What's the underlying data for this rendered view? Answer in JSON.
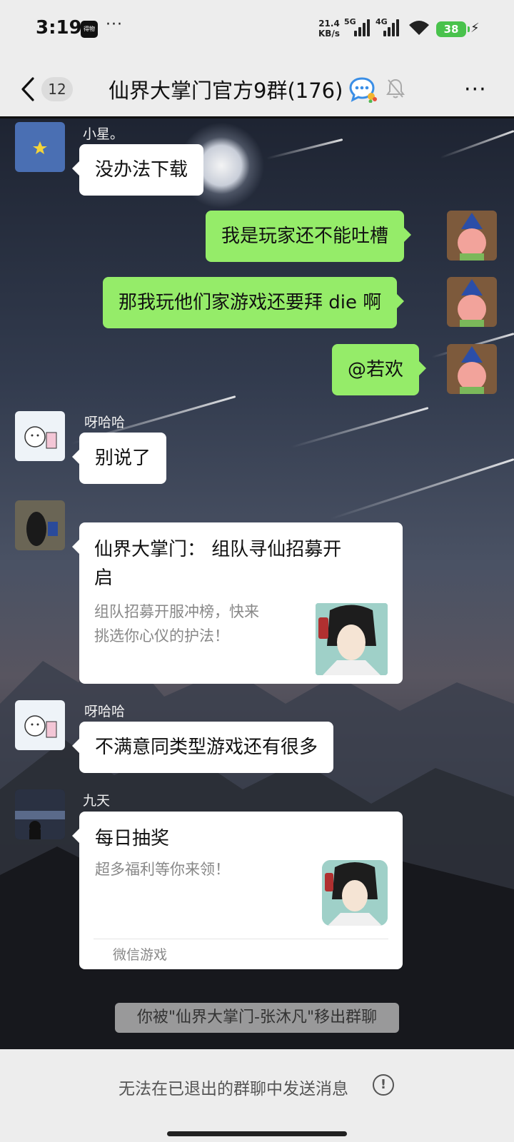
{
  "status_bar": {
    "time": "3:19",
    "app_badge": "得物",
    "dots": "···",
    "net_speed_value": "21.4",
    "net_speed_unit": "KB/s",
    "sim1_label": "5G",
    "sim2_label": "4G",
    "battery": "38"
  },
  "header": {
    "unread_count": "12",
    "title": "仙界大掌门官方9群(176)"
  },
  "messages": [
    {
      "sender": "小星。",
      "text": "没办法下载"
    },
    {
      "text": "我是玩家还不能吐槽"
    },
    {
      "text": "那我玩他们家游戏还要拜 die 啊"
    },
    {
      "text": "@若欢"
    },
    {
      "sender": "呀哈哈",
      "text": "别说了"
    },
    {
      "card_title_line1": "仙界大掌门：  组队寻仙招募开",
      "card_title_line2": "启",
      "card_desc_line1": "组队招募开服冲榜，快来",
      "card_desc_line2": "挑选你心仪的护法！"
    },
    {
      "sender": "呀哈哈",
      "text": "不满意同类型游戏还有很多"
    },
    {
      "sender": "九天",
      "card_title": "每日抽奖",
      "card_desc": "超多福利等你来领！",
      "card_source": "微信游戏"
    }
  ],
  "system_notice": "你被\"仙界大掌门-张沐凡\"移出群聊",
  "footer": {
    "notice": "无法在已退出的群聊中发送消息",
    "info_symbol": "!"
  },
  "colors": {
    "outgoing_bubble": "#95ec69",
    "incoming_bubble": "#ffffff",
    "battery": "#49c24c",
    "background": "#ededed"
  },
  "icons": [
    "back-icon",
    "chat-bubble-icon",
    "mute-bell-icon",
    "more-icon",
    "info-icon",
    "wifi-icon",
    "signal-icon",
    "battery-icon"
  ]
}
